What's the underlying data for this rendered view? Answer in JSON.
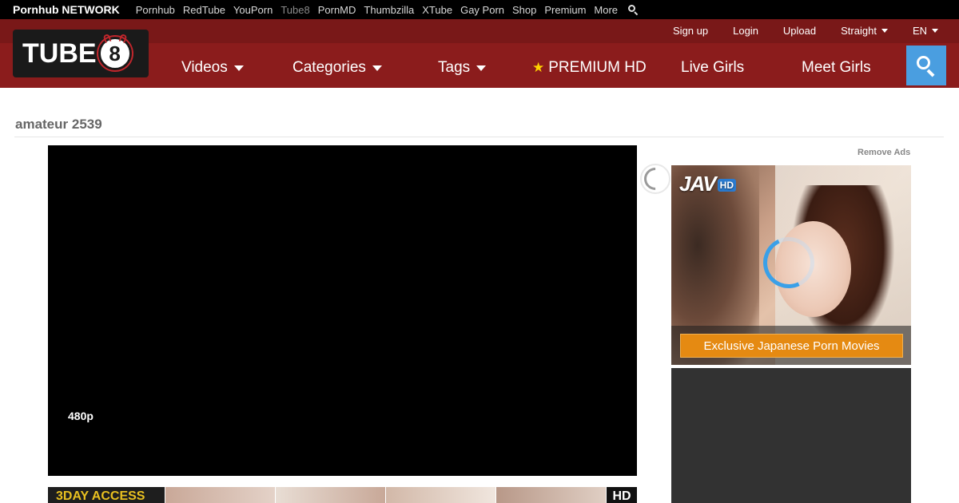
{
  "network": {
    "brand": "Pornhub NETWORK",
    "links": [
      "Pornhub",
      "RedTube",
      "YouPorn",
      "Tube8",
      "PornMD",
      "Thumbzilla",
      "XTube",
      "Gay Porn",
      "Shop",
      "Premium",
      "More"
    ],
    "active_link": "Tube8"
  },
  "header": {
    "logo_text": "TUBE",
    "logo_ball": "8",
    "user_links": {
      "signup": "Sign up",
      "login": "Login",
      "upload": "Upload",
      "orientation": "Straight",
      "language": "EN"
    },
    "nav": {
      "videos": "Videos",
      "categories": "Categories",
      "tags": "Tags",
      "premium": "PREMIUM HD",
      "live_girls": "Live Girls",
      "meet_girls": "Meet Girls"
    },
    "colors": {
      "header_bg": "#8b1c1c",
      "search_button": "#4a9ee0",
      "premium_star": "#ffd200"
    }
  },
  "page": {
    "title": "amateur 2539"
  },
  "player": {
    "quality": "480p"
  },
  "promo": {
    "lead_text": "3DAY ACCESS",
    "hd_badge": "HD"
  },
  "ads": {
    "remove_ads": "Remove Ads",
    "brand": "JAV",
    "brand_badge": "HD",
    "cta": "Exclusive Japanese Porn Movies"
  }
}
